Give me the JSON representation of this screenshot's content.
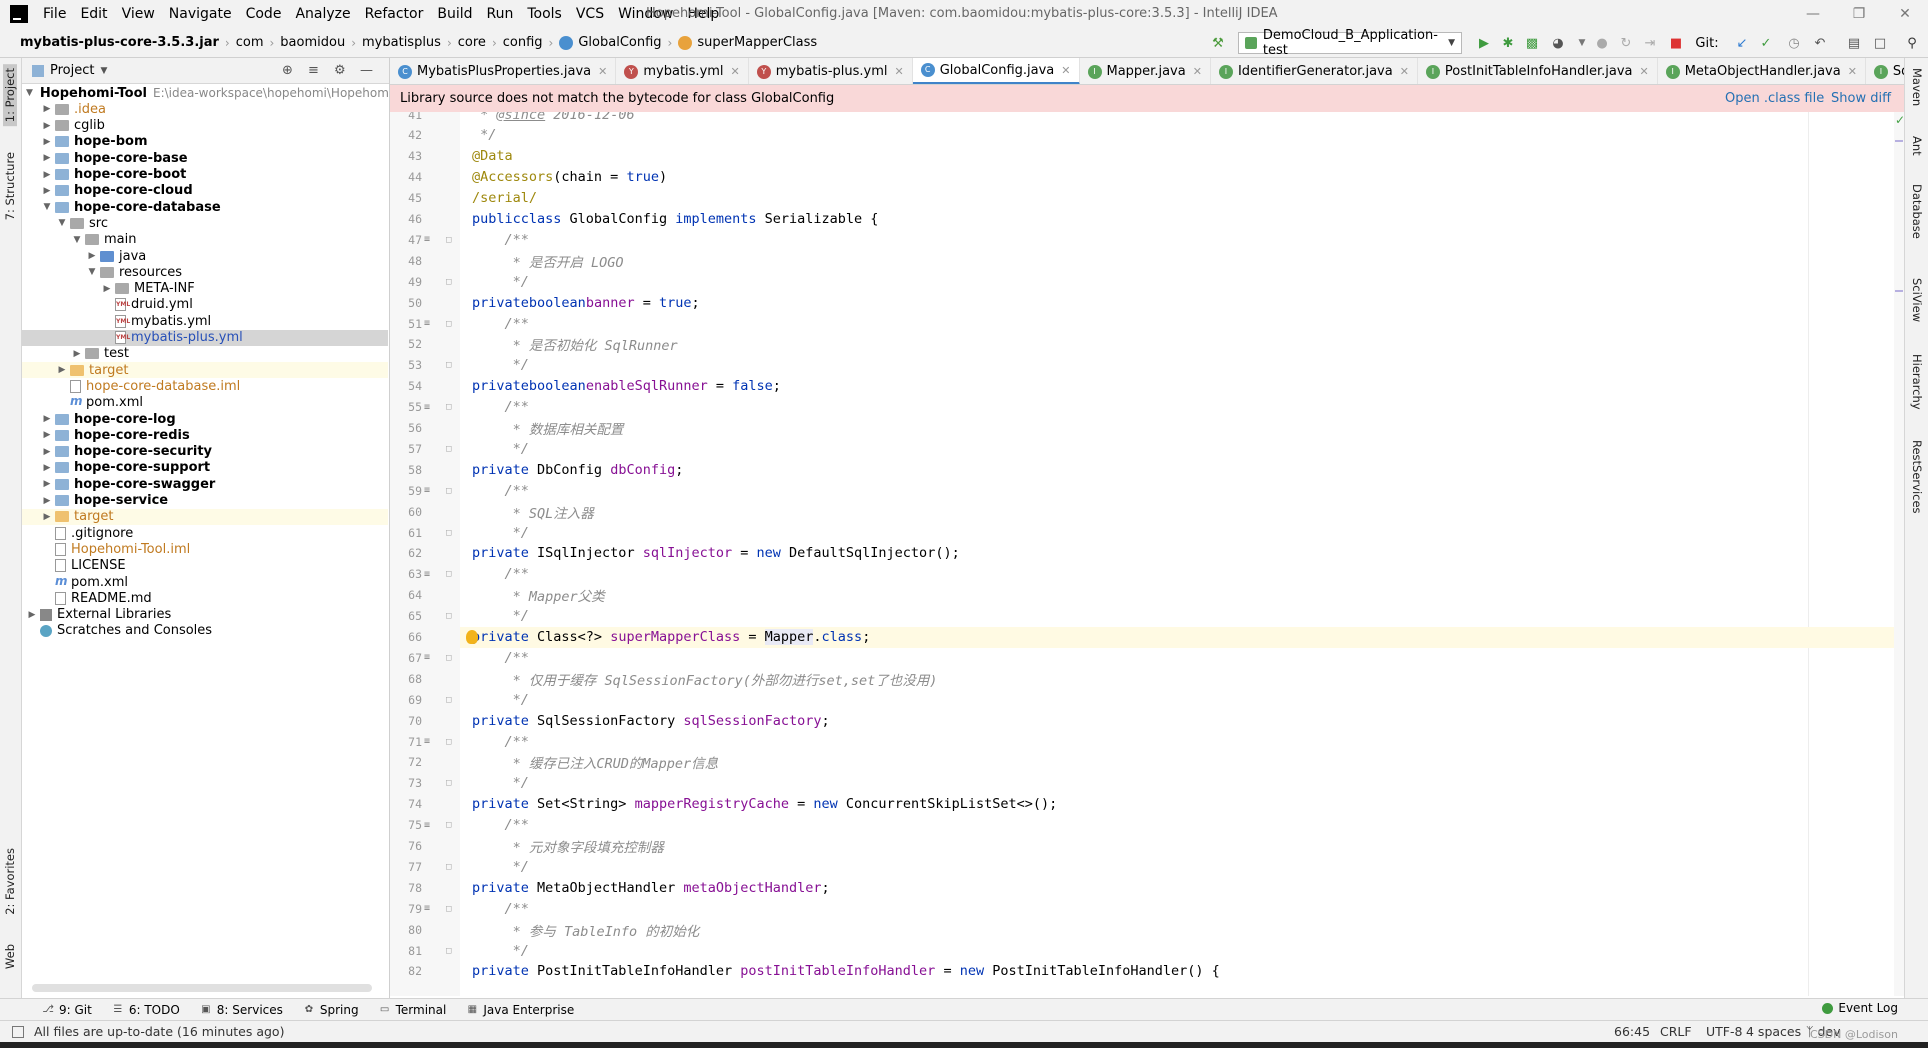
{
  "window": {
    "title": "Hopehomi-Tool - GlobalConfig.java [Maven: com.baomidou:mybatis-plus-core:3.5.3] - IntelliJ IDEA"
  },
  "menu": [
    "File",
    "Edit",
    "View",
    "Navigate",
    "Code",
    "Analyze",
    "Refactor",
    "Build",
    "Run",
    "Tools",
    "VCS",
    "Window",
    "Help"
  ],
  "breadcrumbs": [
    "mybatis-plus-core-3.5.3.jar",
    "com",
    "baomidou",
    "mybatisplus",
    "core",
    "config",
    "GlobalConfig",
    "superMapperClass"
  ],
  "run_config": "DemoCloud_B_Application-test",
  "git_label": "Git:",
  "left_tabs": {
    "project": "1: Project",
    "structure": "7: Structure",
    "favorites": "2: Favorites",
    "web": "Web"
  },
  "right_tabs": [
    "Maven",
    "Ant",
    "Database",
    "SciView",
    "Hierarchy",
    "RestServices"
  ],
  "project_panel": {
    "title": "Project",
    "tree": [
      {
        "label": "Hopehomi-Tool",
        "suffix": "E:\\idea-workspace\\hopehomi\\Hopehom",
        "depth": 0,
        "arrow": "down",
        "icon": "folder-grey",
        "style": "bold"
      },
      {
        "label": ".idea",
        "depth": 1,
        "arrow": "right",
        "icon": "folder-grey",
        "style": "orange"
      },
      {
        "label": "cglib",
        "depth": 1,
        "arrow": "right",
        "icon": "folder-grey",
        "style": "normal"
      },
      {
        "label": "hope-bom",
        "depth": 1,
        "arrow": "right",
        "icon": "folder",
        "style": "bold"
      },
      {
        "label": "hope-core-base",
        "depth": 1,
        "arrow": "right",
        "icon": "folder",
        "style": "bold"
      },
      {
        "label": "hope-core-boot",
        "depth": 1,
        "arrow": "right",
        "icon": "folder",
        "style": "bold"
      },
      {
        "label": "hope-core-cloud",
        "depth": 1,
        "arrow": "right",
        "icon": "folder",
        "style": "bold"
      },
      {
        "label": "hope-core-database",
        "depth": 1,
        "arrow": "down",
        "icon": "folder",
        "style": "bold"
      },
      {
        "label": "src",
        "depth": 2,
        "arrow": "down",
        "icon": "folder-grey",
        "style": "normal"
      },
      {
        "label": "main",
        "depth": 3,
        "arrow": "down",
        "icon": "folder-grey",
        "style": "normal"
      },
      {
        "label": "java",
        "depth": 4,
        "arrow": "right",
        "icon": "folder-blue",
        "style": "normal"
      },
      {
        "label": "resources",
        "depth": 4,
        "arrow": "down",
        "icon": "folder-grey",
        "style": "normal"
      },
      {
        "label": "META-INF",
        "depth": 5,
        "arrow": "right",
        "icon": "folder-grey",
        "style": "normal"
      },
      {
        "label": "druid.yml",
        "depth": 5,
        "arrow": "none",
        "icon": "yml",
        "style": "normal"
      },
      {
        "label": "mybatis.yml",
        "depth": 5,
        "arrow": "none",
        "icon": "yml",
        "style": "normal"
      },
      {
        "label": "mybatis-plus.yml",
        "depth": 5,
        "arrow": "none",
        "icon": "yml",
        "style": "blue",
        "selected": true
      },
      {
        "label": "test",
        "depth": 3,
        "arrow": "right",
        "icon": "folder-grey",
        "style": "normal"
      },
      {
        "label": "target",
        "depth": 2,
        "arrow": "right",
        "icon": "folder-orange",
        "style": "orange",
        "highlight": true
      },
      {
        "label": "hope-core-database.iml",
        "depth": 2,
        "arrow": "none",
        "icon": "file",
        "style": "orange"
      },
      {
        "label": "pom.xml",
        "depth": 2,
        "arrow": "none",
        "icon": "maven",
        "style": "normal"
      },
      {
        "label": "hope-core-log",
        "depth": 1,
        "arrow": "right",
        "icon": "folder",
        "style": "bold"
      },
      {
        "label": "hope-core-redis",
        "depth": 1,
        "arrow": "right",
        "icon": "folder",
        "style": "bold"
      },
      {
        "label": "hope-core-security",
        "depth": 1,
        "arrow": "right",
        "icon": "folder",
        "style": "bold"
      },
      {
        "label": "hope-core-support",
        "depth": 1,
        "arrow": "right",
        "icon": "folder",
        "style": "bold"
      },
      {
        "label": "hope-core-swagger",
        "depth": 1,
        "arrow": "right",
        "icon": "folder",
        "style": "bold"
      },
      {
        "label": "hope-service",
        "depth": 1,
        "arrow": "right",
        "icon": "folder",
        "style": "bold"
      },
      {
        "label": "target",
        "depth": 1,
        "arrow": "right",
        "icon": "folder-orange",
        "style": "orange",
        "highlight": true
      },
      {
        "label": ".gitignore",
        "depth": 1,
        "arrow": "none",
        "icon": "file",
        "style": "normal"
      },
      {
        "label": "Hopehomi-Tool.iml",
        "depth": 1,
        "arrow": "none",
        "icon": "file",
        "style": "orange"
      },
      {
        "label": "LICENSE",
        "depth": 1,
        "arrow": "none",
        "icon": "file",
        "style": "normal"
      },
      {
        "label": "pom.xml",
        "depth": 1,
        "arrow": "none",
        "icon": "maven",
        "style": "normal"
      },
      {
        "label": "README.md",
        "depth": 1,
        "arrow": "none",
        "icon": "file",
        "style": "normal"
      },
      {
        "label": "External Libraries",
        "depth": 0,
        "arrow": "right",
        "icon": "lib",
        "style": "normal"
      },
      {
        "label": "Scratches and Consoles",
        "depth": 0,
        "arrow": "none",
        "icon": "scratch",
        "style": "normal"
      }
    ]
  },
  "tabs": [
    {
      "label": "MybatisPlusProperties.java",
      "icon": "C",
      "color": "#4a8fcf"
    },
    {
      "label": "mybatis.yml",
      "icon": "Y",
      "color": "#c0504d"
    },
    {
      "label": "mybatis-plus.yml",
      "icon": "Y",
      "color": "#c0504d"
    },
    {
      "label": "GlobalConfig.java",
      "icon": "C",
      "color": "#4a8fcf",
      "active": true
    },
    {
      "label": "Mapper.java",
      "icon": "I",
      "color": "#5aa45a"
    },
    {
      "label": "IdentifierGenerator.java",
      "icon": "I",
      "color": "#5aa45a"
    },
    {
      "label": "PostInitTableInfoHandler.java",
      "icon": "I",
      "color": "#5aa45a"
    },
    {
      "label": "MetaObjectHandler.java",
      "icon": "I",
      "color": "#5aa45a"
    },
    {
      "label": "SqlSessionFactory.ja",
      "icon": "I",
      "color": "#5aa45a"
    }
  ],
  "banner": {
    "message": "Library source does not match the bytecode for class GlobalConfig",
    "open_class": "Open .class file",
    "show_diff": "Show diff"
  },
  "code": {
    "first_line": 41,
    "lines": [
      " * @since 2016-12-06",
      " */",
      "@Data",
      "@Accessors(chain = true)",
      "/serial/",
      "public class GlobalConfig implements Serializable {",
      "    /**",
      "     * 是否开启 LOGO",
      "     */",
      "    private boolean banner = true;",
      "    /**",
      "     * 是否初始化 SqlRunner",
      "     */",
      "    private boolean enableSqlRunner = false;",
      "    /**",
      "     * 数据库相关配置",
      "     */",
      "    private DbConfig dbConfig;",
      "    /**",
      "     * SQL注入器",
      "     */",
      "    private ISqlInjector sqlInjector = new DefaultSqlInjector();",
      "    /**",
      "     * Mapper父类",
      "     */",
      "    private Class<?> superMapperClass = Mapper.class;",
      "    /**",
      "     * 仅用于缓存 SqlSessionFactory(外部勿进行set,set了也没用)",
      "     */",
      "    private SqlSessionFactory sqlSessionFactory;",
      "    /**",
      "     * 缓存已注入CRUD的Mapper信息",
      "     */",
      "    private Set<String> mapperRegistryCache = new ConcurrentSkipListSet<>();",
      "    /**",
      "     * 元对象字段填充控制器",
      "     */",
      "    private MetaObjectHandler metaObjectHandler;",
      "    /**",
      "     * 参与 TableInfo 的初始化",
      "     */",
      "    private PostInitTableInfoHandler postInitTableInfoHandler = new PostInitTableInfoHandler() {"
    ],
    "current_line": 66
  },
  "bottom_tools": [
    {
      "label": "9: Git",
      "icon": "git-icon"
    },
    {
      "label": "6: TODO",
      "icon": "list-icon"
    },
    {
      "label": "8: Services",
      "icon": "services-icon"
    },
    {
      "label": "Spring",
      "icon": "spring-icon"
    },
    {
      "label": "Terminal",
      "icon": "terminal-icon"
    },
    {
      "label": "Java Enterprise",
      "icon": "enterprise-icon"
    }
  ],
  "event_log": "Event Log",
  "status": {
    "message": "All files are up-to-date (16 minutes ago)",
    "position": "66:45",
    "line_sep": "CRLF",
    "encoding": "UTF-8",
    "indent": "4 spaces",
    "branch": "dev",
    "watermark": "CSDN @Lodison"
  }
}
